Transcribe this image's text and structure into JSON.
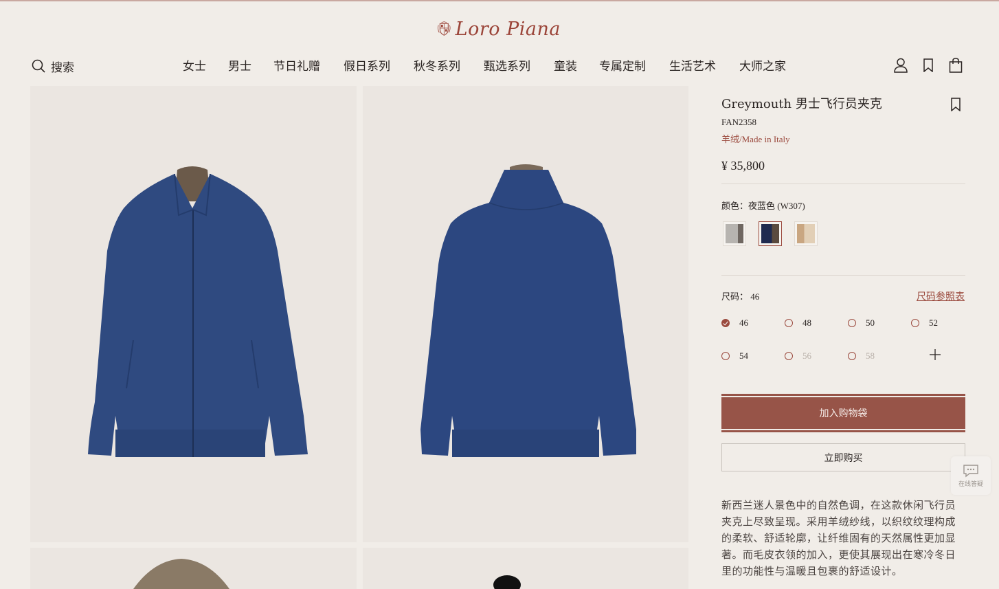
{
  "brand": {
    "name": "Loro Piana",
    "accent": "#9b4a3e"
  },
  "header": {
    "search_label": "搜索",
    "nav": [
      "女士",
      "男士",
      "节日礼赠",
      "假日系列",
      "秋冬系列",
      "甄选系列",
      "童装",
      "专属定制",
      "生活艺术",
      "大师之家"
    ],
    "icons": [
      "user-icon",
      "bookmark-icon",
      "shopping-bag-icon"
    ]
  },
  "product": {
    "title": "Greymouth 男士飞行员夹克",
    "sku": "FAN2358",
    "material": "羊绒/Made in Italy",
    "price": "¥ 35,800",
    "color_label": "颜色：夜蓝色 (W307)",
    "swatches": [
      {
        "name": "grey",
        "colors": [
          "#b7b4b0",
          "#6f6761"
        ]
      },
      {
        "name": "night-blue",
        "colors": [
          "#1f2a4f",
          "#5a4a3e"
        ]
      },
      {
        "name": "beige",
        "colors": [
          "#c9a681",
          "#e2cfb6"
        ]
      }
    ],
    "selected_swatch": 1,
    "size_label": "尺码：  46",
    "size_chart_link": "尺码参照表",
    "sizes": [
      {
        "label": "46",
        "state": "checked"
      },
      {
        "label": "48",
        "state": "available"
      },
      {
        "label": "50",
        "state": "available"
      },
      {
        "label": "52",
        "state": "available"
      },
      {
        "label": "54",
        "state": "available"
      },
      {
        "label": "56",
        "state": "disabled"
      },
      {
        "label": "58",
        "state": "disabled"
      }
    ],
    "add_to_bag": "加入购物袋",
    "buy_now": "立即购买",
    "description": "新西兰迷人景色中的自然色调，在这款休闲飞行员夹克上尽致呈现。采用羊绒纱线，以织纹纹理构成的柔软、舒适轮廓，让纤维固有的天然属性更加显著。而毛皮衣领的加入，更使其展现出在寒冷冬日里的功能性与温暖且包裹的舒适设计。"
  },
  "chat": {
    "label": "在线答疑"
  }
}
